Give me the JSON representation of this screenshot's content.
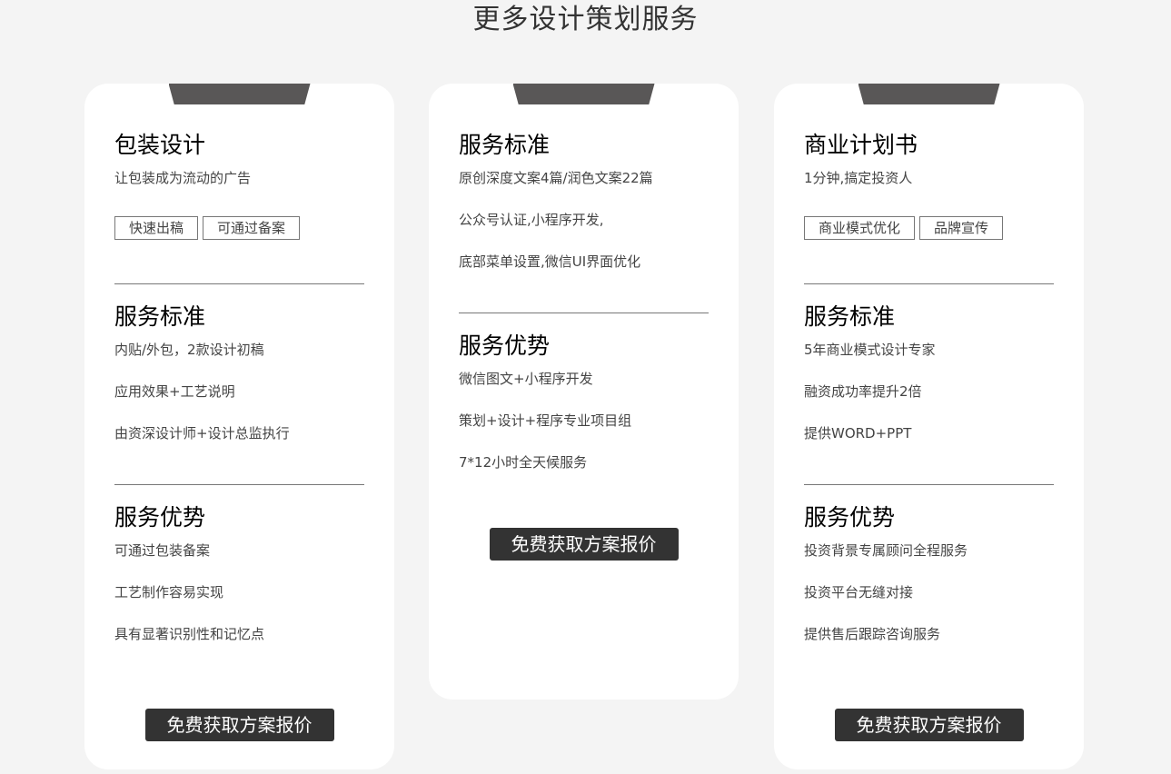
{
  "page": {
    "title": "更多设计策划服务"
  },
  "cards": [
    {
      "title": "包装设计",
      "subtitle": "让包装成为流动的广告",
      "tags": [
        "快速出稿",
        "可通过备案"
      ],
      "sections": [
        {
          "title": "服务标准",
          "items": [
            "内贴/外包，2款设计初稿",
            "应用效果+工艺说明",
            "由资深设计师+设计总监执行"
          ]
        },
        {
          "title": "服务优势",
          "items": [
            "可通过包装备案",
            "工艺制作容易实现",
            "具有显著识别性和记忆点"
          ]
        }
      ],
      "cta": "免费获取方案报价"
    },
    {
      "sections": [
        {
          "title": "服务标准",
          "items": [
            "原创深度文案4篇/润色文案22篇",
            "公众号认证,小程序开发,",
            "底部菜单设置,微信UI界面优化"
          ]
        },
        {
          "title": "服务优势",
          "items": [
            "微信图文+小程序开发",
            "策划+设计+程序专业项目组",
            "7*12小时全天候服务"
          ]
        }
      ],
      "cta": "免费获取方案报价"
    },
    {
      "title": "商业计划书",
      "subtitle": "1分钟,搞定投资人",
      "tags": [
        "商业模式优化",
        "品牌宣传"
      ],
      "sections": [
        {
          "title": "服务标准",
          "items": [
            "5年商业模式设计专家",
            "融资成功率提升2倍",
            "提供WORD+PPT"
          ]
        },
        {
          "title": "服务优势",
          "items": [
            "投资背景专属顾问全程服务",
            "投资平台无缝对接",
            "提供售后跟踪咨询服务"
          ]
        }
      ],
      "cta": "免费获取方案报价"
    }
  ],
  "colors": {
    "background": "#f4f4f4",
    "card": "#ffffff",
    "notch": "#595757",
    "button": "#333333"
  }
}
